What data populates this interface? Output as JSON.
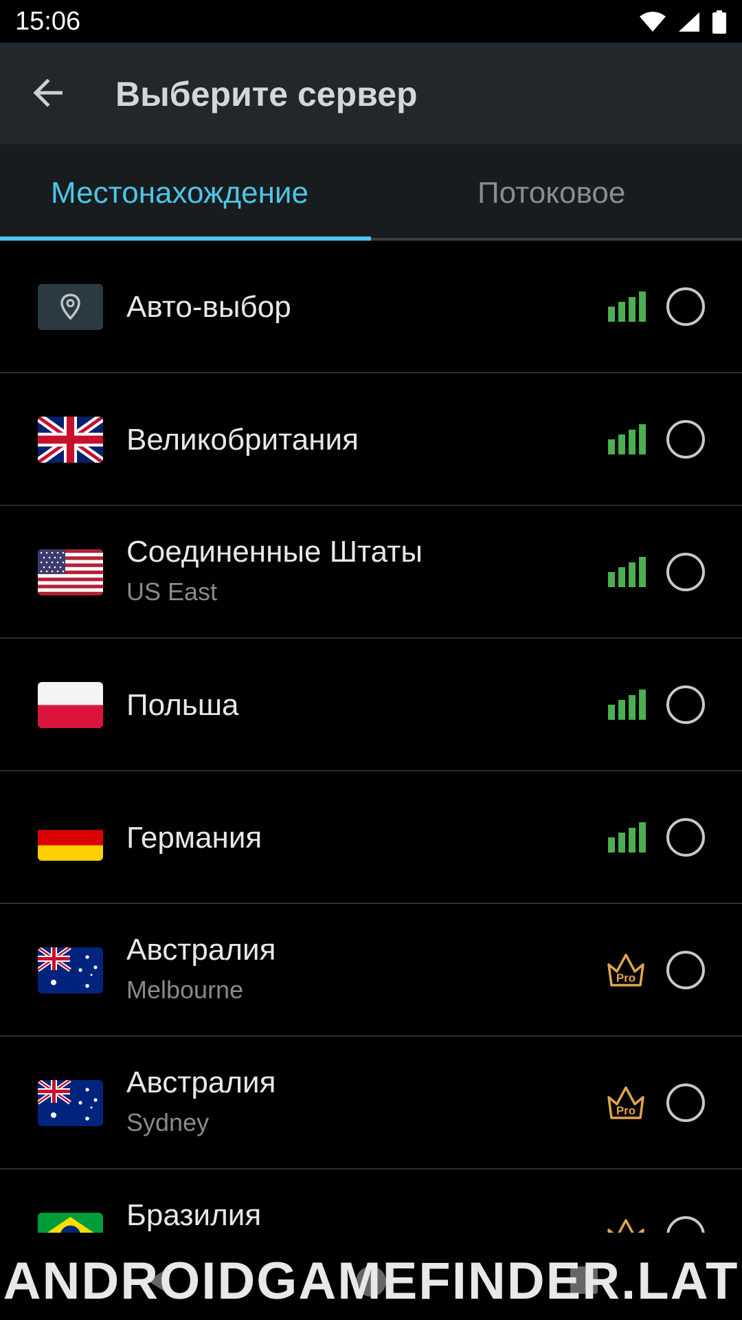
{
  "status_bar": {
    "time": "15:06"
  },
  "app_bar": {
    "title": "Выберите сервер"
  },
  "tabs": [
    {
      "label": "Местонахождение",
      "selected": true
    },
    {
      "label": "Потоковое",
      "selected": false
    }
  ],
  "servers": [
    {
      "title": "Авто-выбор",
      "subtitle": "",
      "flag": "location-pin-icon",
      "badge": "signal-strength-icon"
    },
    {
      "title": "Великобритания",
      "subtitle": "",
      "flag": "uk-flag-icon",
      "badge": "signal-strength-icon"
    },
    {
      "title": "Соединенные Штаты",
      "subtitle": "US East",
      "flag": "us-flag-icon",
      "badge": "signal-strength-icon"
    },
    {
      "title": "Польша",
      "subtitle": "",
      "flag": "poland-flag-icon",
      "badge": "signal-strength-icon"
    },
    {
      "title": "Германия",
      "subtitle": "",
      "flag": "germany-flag-icon",
      "badge": "signal-strength-icon"
    },
    {
      "title": "Австралия",
      "subtitle": "Melbourne",
      "flag": "australia-flag-icon",
      "badge": "pro-crown-icon"
    },
    {
      "title": "Австралия",
      "subtitle": "Sydney",
      "flag": "australia-flag-icon",
      "badge": "pro-crown-icon"
    },
    {
      "title": "Бразилия",
      "subtitle": "",
      "flag": "brazil-flag-icon",
      "badge": "pro-crown-icon"
    }
  ],
  "badges": {
    "pro_label": "Pro"
  },
  "watermark": "ANDROIDGAMEFINDER.LAT",
  "colors": {
    "accent": "#4dc6e8",
    "signal": "#4caf50",
    "pro": "#e0a64a"
  }
}
